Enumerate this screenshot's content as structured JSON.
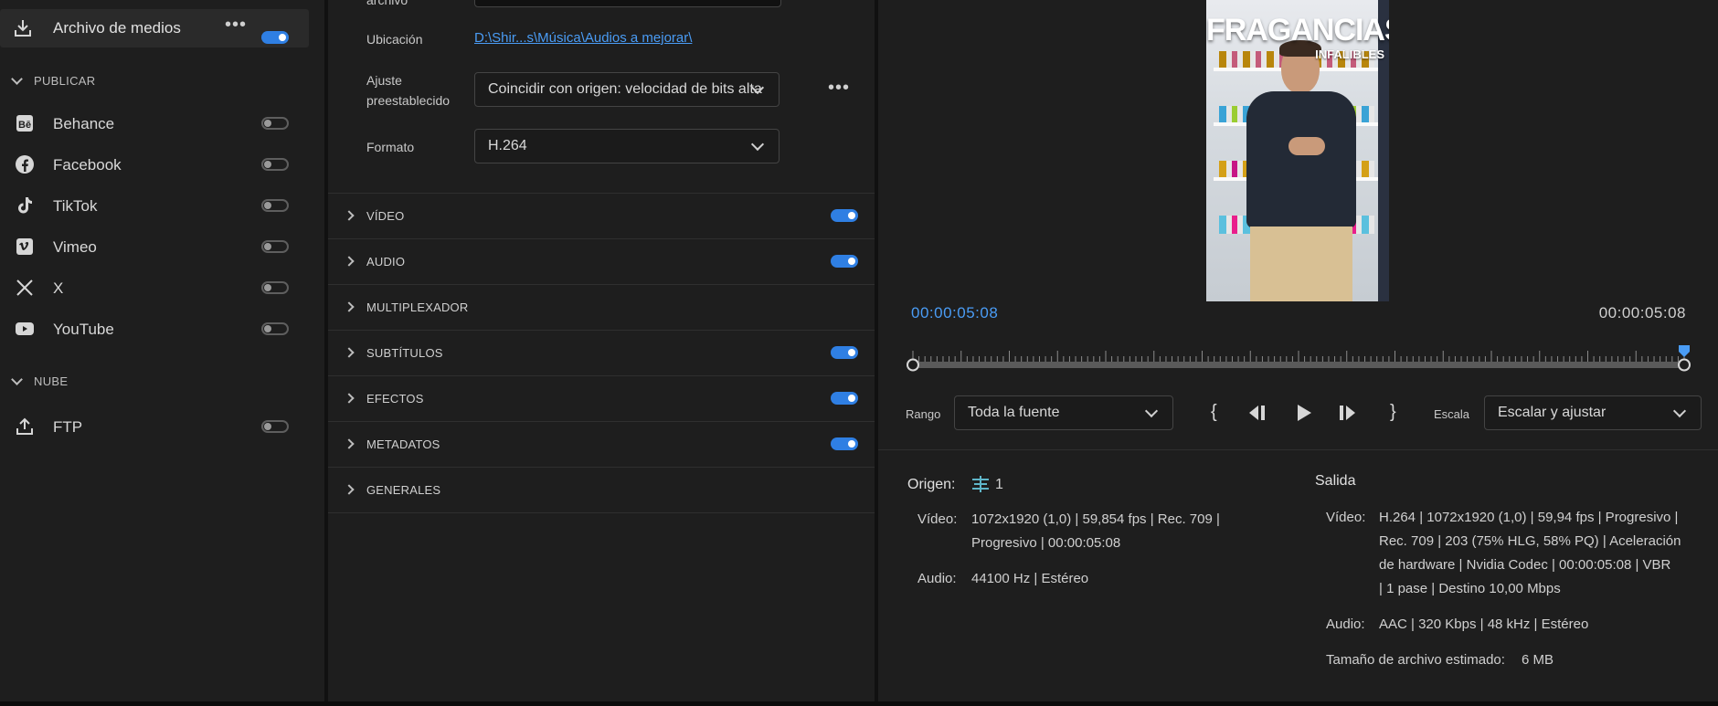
{
  "left": {
    "media_file": {
      "label": "Archivo de medios",
      "enabled": true
    },
    "publish_heading": "PUBLICAR",
    "publish_items": [
      {
        "label": "Behance",
        "icon": "behance-icon",
        "enabled": false
      },
      {
        "label": "Facebook",
        "icon": "facebook-icon",
        "enabled": false
      },
      {
        "label": "TikTok",
        "icon": "tiktok-icon",
        "enabled": false
      },
      {
        "label": "Vimeo",
        "icon": "vimeo-icon",
        "enabled": false
      },
      {
        "label": "X",
        "icon": "x-icon",
        "enabled": false
      },
      {
        "label": "YouTube",
        "icon": "youtube-icon",
        "enabled": false
      }
    ],
    "cloud_heading": "NUBE",
    "cloud_items": [
      {
        "label": "FTP",
        "icon": "upload-icon",
        "enabled": false
      }
    ]
  },
  "mid": {
    "filename_label_partial": "archivo",
    "location_label": "Ubicación",
    "location_value": "D:\\Shir...s\\Música\\Audios a mejorar\\",
    "preset_label_line1": "Ajuste",
    "preset_label_line2": "preestablecido",
    "preset_value": "Coincidir con origen: velocidad de bits alta",
    "format_label": "Formato",
    "format_value": "H.264",
    "sections": [
      {
        "label": "VÍDEO",
        "has_toggle": true,
        "enabled": true
      },
      {
        "label": "AUDIO",
        "has_toggle": true,
        "enabled": true
      },
      {
        "label": "MULTIPLEXADOR",
        "has_toggle": false
      },
      {
        "label": "SUBTÍTULOS",
        "has_toggle": true,
        "enabled": true
      },
      {
        "label": "EFECTOS",
        "has_toggle": true,
        "enabled": true
      },
      {
        "label": "METADATOS",
        "has_toggle": true,
        "enabled": true
      },
      {
        "label": "GENERALES",
        "has_toggle": false
      }
    ]
  },
  "preview": {
    "video_title": "FRAGANCIAS",
    "video_subtitle": "INFALIBLES",
    "current_time": "00:00:05:08",
    "duration": "00:00:05:08",
    "playhead_fraction": 1.0,
    "range_label": "Rango",
    "range_value": "Toda la fuente",
    "scale_label": "Escala",
    "scale_value": "Escalar y ajustar",
    "accent_color": "#4a9cf5"
  },
  "info": {
    "source_heading": "Origen:",
    "source_count": "1",
    "source_video_label": "Vídeo:",
    "source_video_line1": "1072x1920 (1,0)  |  59,854 fps  |  Rec. 709  |",
    "source_video_line2": "Progresivo  |  00:00:05:08",
    "source_audio_label": "Audio:",
    "source_audio_value": "44100 Hz  |  Estéreo",
    "output_heading": "Salida",
    "output_video_label": "Vídeo:",
    "output_video_line1": "H.264  |  1072x1920 (1,0)  |  59,94 fps  |  Progresivo  |",
    "output_video_line2": "Rec. 709  |  203 (75% HLG, 58% PQ)  |   Aceleración",
    "output_video_line3": "de hardware  |  Nvidia Codec  |  00:00:05:08  |  VBR",
    "output_video_line4": "|  1 pase  |  Destino 10,00 Mbps",
    "output_audio_label": "Audio:",
    "output_audio_value": "AAC  |  320 Kbps  |  48 kHz  |  Estéreo",
    "filesize_label": "Tamaño de archivo estimado:",
    "filesize_value": "6 MB"
  }
}
